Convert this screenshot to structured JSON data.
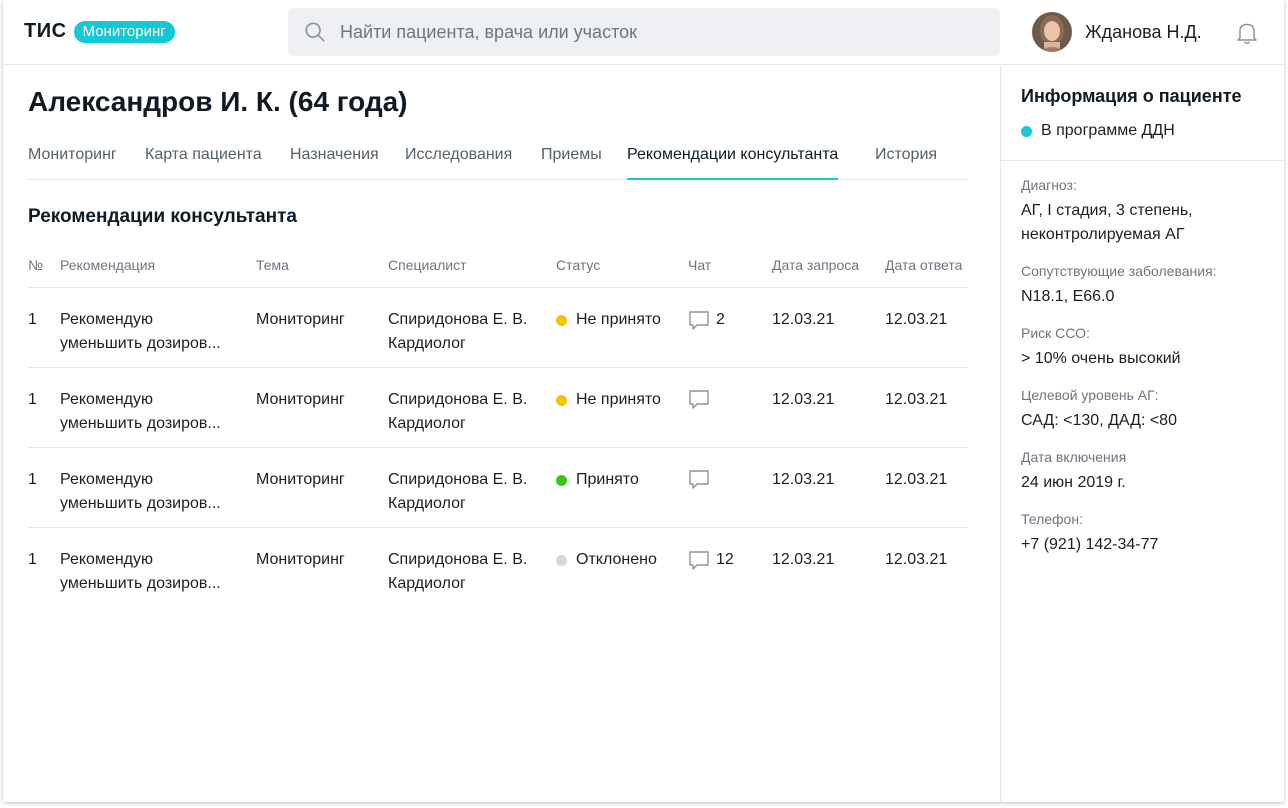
{
  "header": {
    "logo_text": "ТИС",
    "logo_badge": "Мониторинг",
    "search_placeholder": "Найти пациента, врача или участок",
    "user_name": "Жданова Н.Д."
  },
  "patient": {
    "title": "Александров И. К. (64 года)"
  },
  "tabs": [
    {
      "label": "Мониторинг",
      "active": false
    },
    {
      "label": "Карта пациента",
      "active": false
    },
    {
      "label": "Назначения",
      "active": false
    },
    {
      "label": "Исследования",
      "active": false
    },
    {
      "label": "Приемы",
      "active": false
    },
    {
      "label": "Рекомендации консультанта",
      "active": true
    },
    {
      "label": "История",
      "active": false
    }
  ],
  "section_title": "Рекомендации консультанта",
  "table": {
    "columns": [
      "№",
      "Рекомендация",
      "Тема",
      "Специалист",
      "Статус",
      "Чат",
      "Дата запроса",
      "Дата ответа"
    ],
    "rows": [
      {
        "num": "1",
        "rec_line1": "Рекомендую",
        "rec_line2": "уменьшить дозиров...",
        "topic": "Мониторинг",
        "spec_line1": "Спиридонова Е. В.",
        "spec_line2": "Кардиолог",
        "status": "Не принято",
        "status_color": "#f5c400",
        "chat": "2",
        "date_request": "12.03.21",
        "date_answer": "12.03.21"
      },
      {
        "num": "1",
        "rec_line1": "Рекомендую",
        "rec_line2": "уменьшить дозиров...",
        "topic": "Мониторинг",
        "spec_line1": "Спиридонова Е. В.",
        "spec_line2": "Кардиолог",
        "status": "Не принято",
        "status_color": "#f5c400",
        "chat": "",
        "date_request": "12.03.21",
        "date_answer": "12.03.21"
      },
      {
        "num": "1",
        "rec_line1": "Рекомендую",
        "rec_line2": "уменьшить дозиров...",
        "topic": "Мониторинг",
        "spec_line1": "Спиридонова Е. В.",
        "spec_line2": "Кардиолог",
        "status": "Принято",
        "status_color": "#3cc414",
        "chat": "",
        "date_request": "12.03.21",
        "date_answer": "12.03.21"
      },
      {
        "num": "1",
        "rec_line1": "Рекомендую",
        "rec_line2": "уменьшить дозиров...",
        "topic": "Мониторинг",
        "spec_line1": "Спиридонова Е. В.",
        "spec_line2": "Кардиолог",
        "status": "Отклонено",
        "status_color": "#d5d8dc",
        "chat": "12",
        "date_request": "12.03.21",
        "date_answer": "12.03.21"
      }
    ]
  },
  "sidebar": {
    "title": "Информация о пациенте",
    "program": "В программе ДДН",
    "program_color": "#14c8d6",
    "fields": [
      {
        "label": "Диагноз:",
        "value_line1": "АГ, I стадия, 3 степень,",
        "value_line2": "неконтролируемая АГ"
      },
      {
        "label": "Сопутствующие заболевания:",
        "value_line1": "N18.1, E66.0",
        "value_line2": ""
      },
      {
        "label": "Риск ССО:",
        "value_line1": "> 10% очень высокий",
        "value_line2": ""
      },
      {
        "label": "Целевой уровень АГ:",
        "value_line1": "САД: <130, ДАД: <80",
        "value_line2": ""
      },
      {
        "label": "Дата включения",
        "value_line1": "24 июн 2019 г.",
        "value_line2": ""
      },
      {
        "label": "Телефон:",
        "value_line1": "+7 (921) 142-34-77",
        "value_line2": ""
      }
    ]
  },
  "colors": {
    "accent": "#14c8d6",
    "pending": "#f5c400",
    "accepted": "#3cc414",
    "declined": "#d5d8dc"
  },
  "icons": [
    "search-icon",
    "bell-icon",
    "chat-icon",
    "avatar"
  ]
}
